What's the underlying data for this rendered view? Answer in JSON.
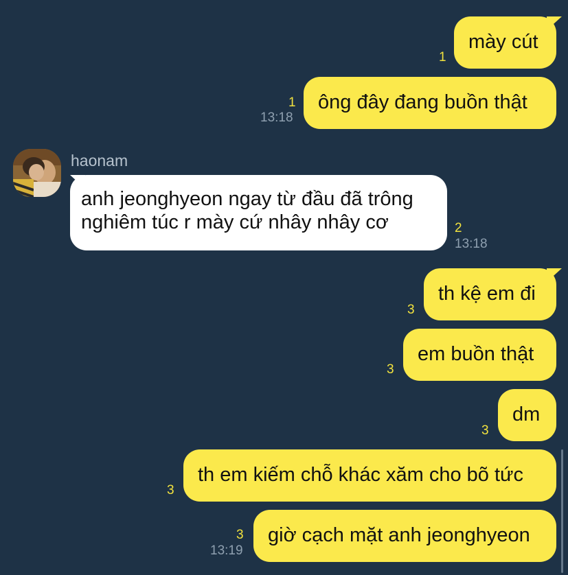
{
  "messages": [
    {
      "text": "mày cút",
      "unread": "1",
      "time": ""
    },
    {
      "text": "ông đây đang buồn thật",
      "unread": "1",
      "time": "13:18"
    },
    {
      "sender": "haonam",
      "text": "anh jeonghyeon ngay từ đầu đã trông nghiêm túc r mày cứ nhây nhây cơ",
      "unread": "2",
      "time": "13:18"
    },
    {
      "text": "th kệ em đi",
      "unread": "3",
      "time": ""
    },
    {
      "text": "em buồn thật",
      "unread": "3",
      "time": ""
    },
    {
      "text": "dm",
      "unread": "3",
      "time": ""
    },
    {
      "text": "th em kiếm chỗ khác xăm cho bõ tức",
      "unread": "3",
      "time": ""
    },
    {
      "text": "giờ cạch mặt anh jeonghyeon",
      "unread": "3",
      "time": "13:19"
    }
  ],
  "colors": {
    "background": "#1e3246",
    "outgoing_bubble": "#fbe94c",
    "incoming_bubble": "#ffffff",
    "unread_count": "#f2e23e",
    "timestamp": "#8fa0b0"
  }
}
